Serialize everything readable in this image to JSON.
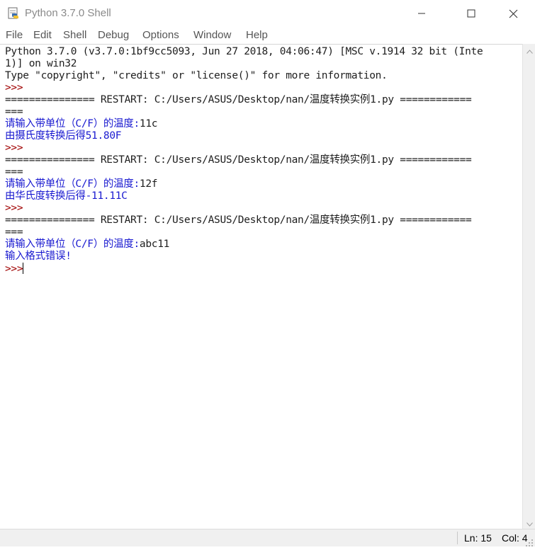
{
  "window": {
    "title": "Python 3.7.0 Shell"
  },
  "menu": {
    "items": [
      "File",
      "Edit",
      "Shell",
      "Debug",
      "Options",
      "Window",
      "Help"
    ]
  },
  "console": {
    "lines": [
      {
        "text": "Python 3.7.0 (v3.7.0:1bf9cc5093, Jun 27 2018, 04:06:47) [MSC v.1914 32 bit (Inte",
        "kind": "out"
      },
      {
        "text": "1)] on win32",
        "kind": "out"
      },
      {
        "text": "Type \"copyright\", \"credits\" or \"license()\" for more information.",
        "kind": "out"
      },
      {
        "text": ">>>",
        "kind": "prompt"
      },
      {
        "text": "=============== RESTART: C:/Users/ASUS/Desktop/nan/温度转换实例1.py ============",
        "kind": "restart"
      },
      {
        "text": "===",
        "kind": "restart"
      },
      {
        "text": "请输入带单位（C/F）的温度:",
        "kind": "stdout",
        "input": "11c"
      },
      {
        "text": "由摄氏度转换后得51.80F",
        "kind": "stdout"
      },
      {
        "text": ">>>",
        "kind": "prompt"
      },
      {
        "text": "=============== RESTART: C:/Users/ASUS/Desktop/nan/温度转换实例1.py ============",
        "kind": "restart"
      },
      {
        "text": "===",
        "kind": "restart"
      },
      {
        "text": "请输入带单位（C/F）的温度:",
        "kind": "stdout",
        "input": "12f"
      },
      {
        "text": "由华氏度转换后得-11.11C",
        "kind": "stdout"
      },
      {
        "text": ">>>",
        "kind": "prompt"
      },
      {
        "text": "=============== RESTART: C:/Users/ASUS/Desktop/nan/温度转换实例1.py ============",
        "kind": "restart"
      },
      {
        "text": "===",
        "kind": "restart"
      },
      {
        "text": "请输入带单位（C/F）的温度:",
        "kind": "stdout",
        "input": "abc11"
      },
      {
        "text": "输入格式错误!",
        "kind": "stdout"
      },
      {
        "text": ">>>",
        "kind": "prompt",
        "cursor": true
      }
    ]
  },
  "status": {
    "ln_label": "Ln: 15",
    "col_label": "Col: 4"
  },
  "icons": {
    "app": "python-idle-icon",
    "minimize": "minimize-icon",
    "maximize": "maximize-icon",
    "close": "close-icon"
  },
  "colors": {
    "stdout": "#1a1ad0",
    "prompt": "#a00000",
    "text": "#1e1e1e"
  }
}
